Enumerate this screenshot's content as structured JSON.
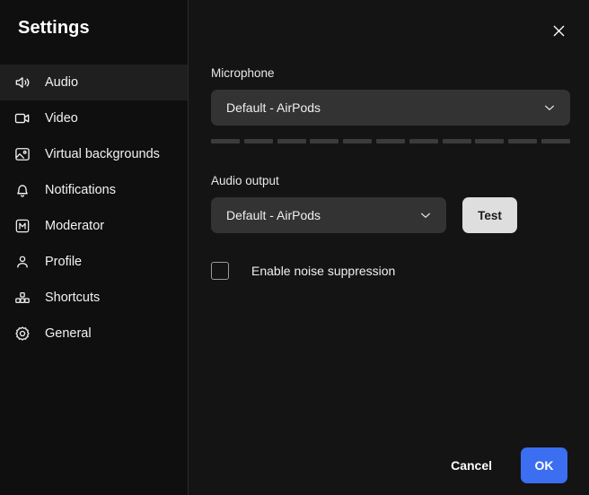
{
  "window": {
    "title": "Settings",
    "close_icon": "close-icon"
  },
  "sidebar": {
    "items": [
      {
        "label": "Audio",
        "icon": "speaker-icon",
        "active": true
      },
      {
        "label": "Video",
        "icon": "video-camera-icon",
        "active": false
      },
      {
        "label": "Virtual backgrounds",
        "icon": "image-icon",
        "active": false
      },
      {
        "label": "Notifications",
        "icon": "bell-icon",
        "active": false
      },
      {
        "label": "Moderator",
        "icon": "moderator-m-icon",
        "active": false
      },
      {
        "label": "Profile",
        "icon": "person-icon",
        "active": false
      },
      {
        "label": "Shortcuts",
        "icon": "shortcuts-keys-icon",
        "active": false
      },
      {
        "label": "General",
        "icon": "gear-icon",
        "active": false
      }
    ]
  },
  "main": {
    "microphone": {
      "label": "Microphone",
      "selected": "Default - AirPods",
      "chevron_icon": "chevron-down-icon",
      "level_segments": 11,
      "level_active": 0
    },
    "audio_output": {
      "label": "Audio output",
      "selected": "Default - AirPods",
      "chevron_icon": "chevron-down-icon",
      "test_label": "Test"
    },
    "noise_suppression": {
      "label": "Enable noise suppression",
      "checked": false
    }
  },
  "footer": {
    "cancel_label": "Cancel",
    "ok_label": "OK"
  },
  "colors": {
    "accent": "#3b6ef0",
    "sidebar_bg": "#0f0f0f",
    "main_bg": "#141414",
    "active_item_bg": "#1f1f1f",
    "select_bg": "#333333",
    "test_button_bg": "#dedede",
    "meter_segment": "#3b3b3b"
  }
}
